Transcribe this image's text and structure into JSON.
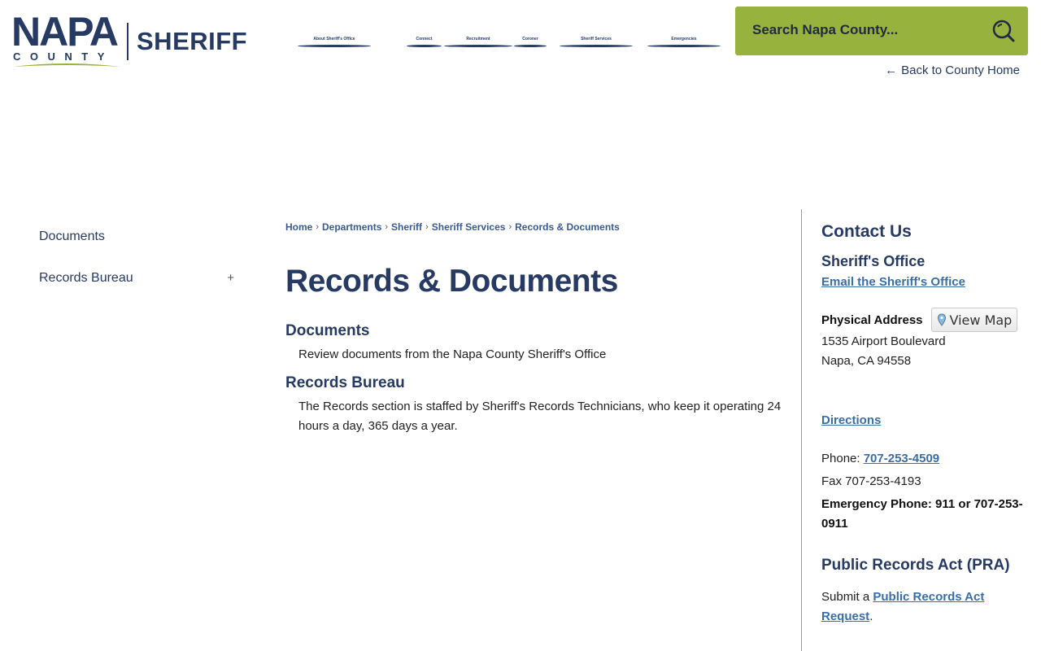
{
  "logo": {
    "wordmark": "NAPA",
    "sub": "COUNTY",
    "dept": "SHERIFF"
  },
  "nav": [
    "About Sheriff's Office",
    "Connect",
    "Recruitment",
    "Coroner",
    "Sheriff Services",
    "Emergencies"
  ],
  "search": {
    "placeholder": "Search Napa County..."
  },
  "back_home": "Back to County Home",
  "sidebar": {
    "items": [
      {
        "label": "Documents",
        "expand": ""
      },
      {
        "label": "Records Bureau",
        "expand": "+"
      }
    ]
  },
  "breadcrumb": [
    "Home",
    "Departments",
    "Sheriff",
    "Sheriff Services",
    "Records & Documents"
  ],
  "page_title": "Records & Documents",
  "sections": [
    {
      "heading": "Documents",
      "desc": "Review documents from the Napa County Sheriff's Office"
    },
    {
      "heading": "Records Bureau",
      "desc": "The Records section is staffed by Sheriff's Records Technicians, who keep it operating 24 hours a day, 365 days a year."
    }
  ],
  "contact": {
    "title": "Contact Us",
    "office": "Sheriff's Office",
    "email_link": "Email the Sheriff's Office",
    "physical_label": "Physical Address",
    "view_map": "View Map",
    "address_line1": "1535 Airport Boulevard",
    "address_line2": "Napa, CA 94558",
    "directions": "Directions",
    "phone_label": "Phone:",
    "phone": "707-253-4509",
    "fax": "Fax 707-253-4193",
    "emergency": "Emergency Phone: 911 or 707-253-0911",
    "pra_heading": "Public Records Act (PRA)",
    "pra_prefix": "Submit a",
    "pra_link": "Public Records Act Request",
    "pra_suffix": "."
  },
  "colors": {
    "navy": "#263a64",
    "green": "#98b23e",
    "link": "#3a6ea8"
  }
}
